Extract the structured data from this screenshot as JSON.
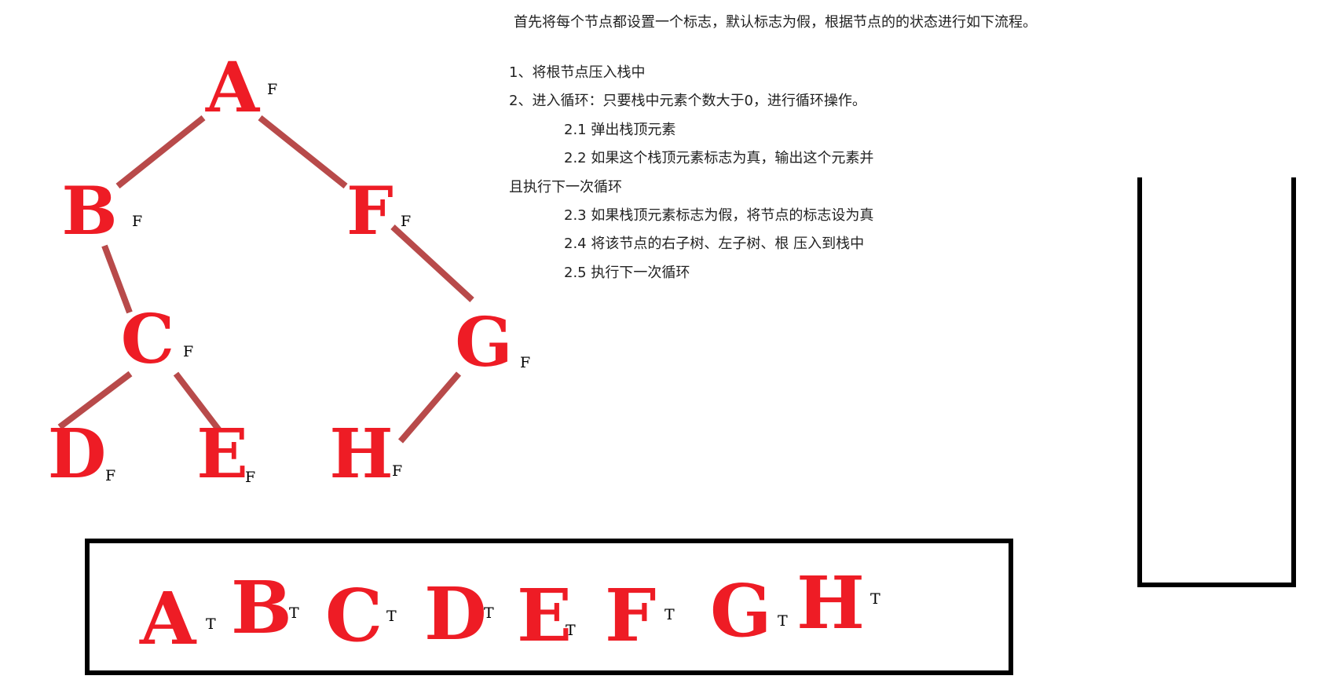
{
  "tree": {
    "nodes": [
      {
        "id": "A",
        "label": "A",
        "flag": "F"
      },
      {
        "id": "B",
        "label": "B",
        "flag": "F"
      },
      {
        "id": "F",
        "label": "F",
        "flag": "F"
      },
      {
        "id": "C",
        "label": "C",
        "flag": "F"
      },
      {
        "id": "G",
        "label": "G",
        "flag": "F"
      },
      {
        "id": "D",
        "label": "D",
        "flag": "F"
      },
      {
        "id": "E",
        "label": "E",
        "flag": "F"
      },
      {
        "id": "H",
        "label": "H",
        "flag": "F"
      }
    ],
    "edges": [
      [
        "A",
        "B"
      ],
      [
        "A",
        "F"
      ],
      [
        "B",
        "C"
      ],
      [
        "F",
        "G"
      ],
      [
        "C",
        "D"
      ],
      [
        "C",
        "E"
      ],
      [
        "G",
        "H"
      ]
    ],
    "node_color": "#ee1c25",
    "edge_color": "#b84a4a"
  },
  "instructions": {
    "intro": "首先将每个节点都设置一个标志，默认标志为假，根据节点的的状态进行如下流程。",
    "steps": [
      "1、将根节点压入栈中",
      "2、进入循环：只要栈中元素个数大于0，进行循环操作。",
      "2.1 弹出栈顶元素",
      "2.2 如果这个栈顶元素标志为真，输出这个元素并",
      "且执行下一次循环",
      "2.3 如果栈顶元素标志为假，将节点的标志设为真",
      "2.4 将该节点的右子树、左子树、根 压入到栈中",
      "2.5 执行下一次循环"
    ]
  },
  "output": {
    "items": [
      {
        "label": "A",
        "flag": "T"
      },
      {
        "label": "B",
        "flag": "T"
      },
      {
        "label": "C",
        "flag": "T"
      },
      {
        "label": "D",
        "flag": "T"
      },
      {
        "label": "E",
        "flag": "T"
      },
      {
        "label": "F",
        "flag": "T"
      },
      {
        "label": "G",
        "flag": "T"
      },
      {
        "label": "H",
        "flag": "T"
      }
    ]
  }
}
